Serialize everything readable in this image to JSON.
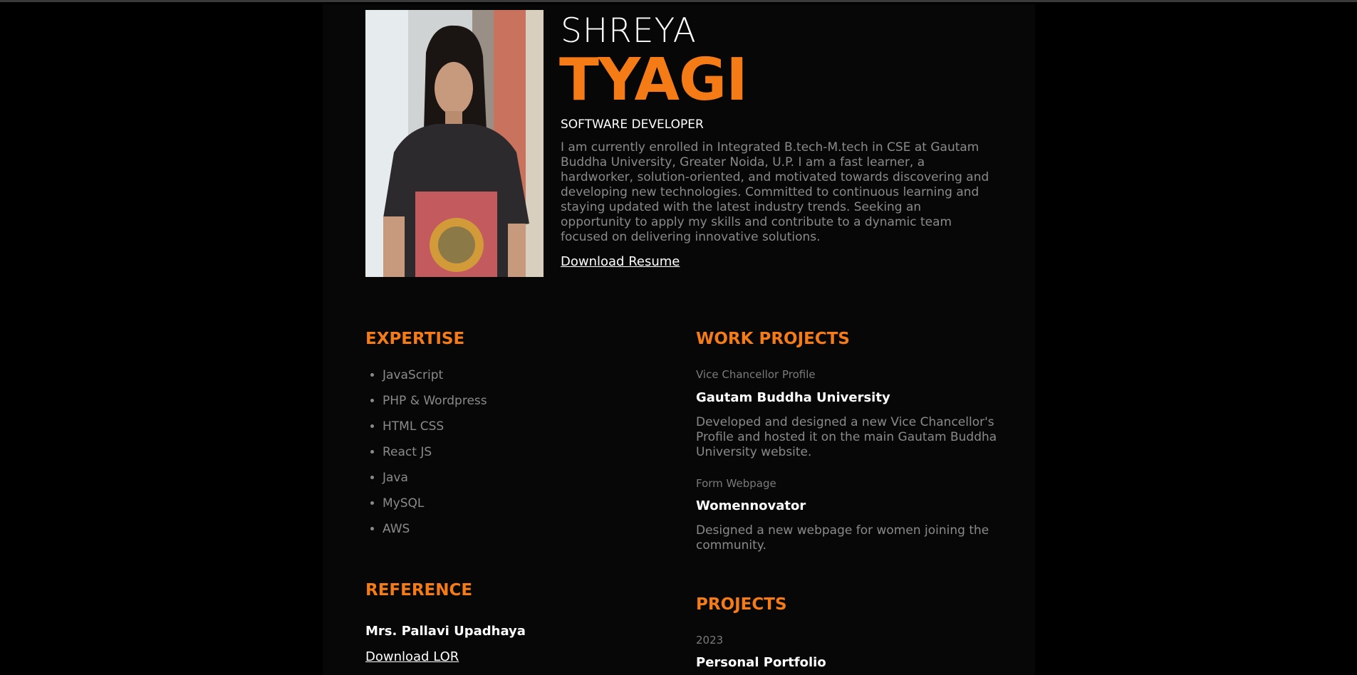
{
  "header": {
    "first_name": "SHREYA",
    "last_name": "TYAGI",
    "role": "SOFTWARE DEVELOPER",
    "bio": "I am currently enrolled in Integrated B.tech-M.tech in CSE at Gautam Buddha University, Greater Noida, U.P. I am a fast learner, a hardworker, solution-oriented, and motivated towards discovering and developing new technologies. Committed to continuous learning and staying updated with the latest industry trends. Seeking an opportunity to apply my skills and contribute to a dynamic team focused on delivering innovative solutions.",
    "resume_link": "Download Resume"
  },
  "expertise": {
    "title": "EXPERTISE",
    "items": [
      "JavaScript",
      "PHP & Wordpress",
      "HTML CSS",
      "React JS",
      "Java",
      "MySQL",
      "AWS"
    ]
  },
  "work_projects": {
    "title": "WORK PROJECTS",
    "items": [
      {
        "kicker": "Vice Chancellor Profile",
        "title": "Gautam Buddha University",
        "description": "Developed and designed a new Vice Chancellor's Profile and hosted it on the main Gautam Buddha University website."
      },
      {
        "kicker": "Form Webpage",
        "title": "Womennovator",
        "description": "Designed a new webpage for women joining the community."
      }
    ]
  },
  "reference": {
    "title": "REFERENCE",
    "name": "Mrs. Pallavi Upadhaya",
    "lor_link": "Download LOR"
  },
  "projects": {
    "title": "PROJECTS",
    "items": [
      {
        "year": "2023",
        "title": "Personal Portfolio"
      }
    ]
  },
  "colors": {
    "accent": "#f47b16",
    "background": "#070707",
    "text_primary": "#ffffff",
    "text_muted": "#8a8a8a"
  }
}
